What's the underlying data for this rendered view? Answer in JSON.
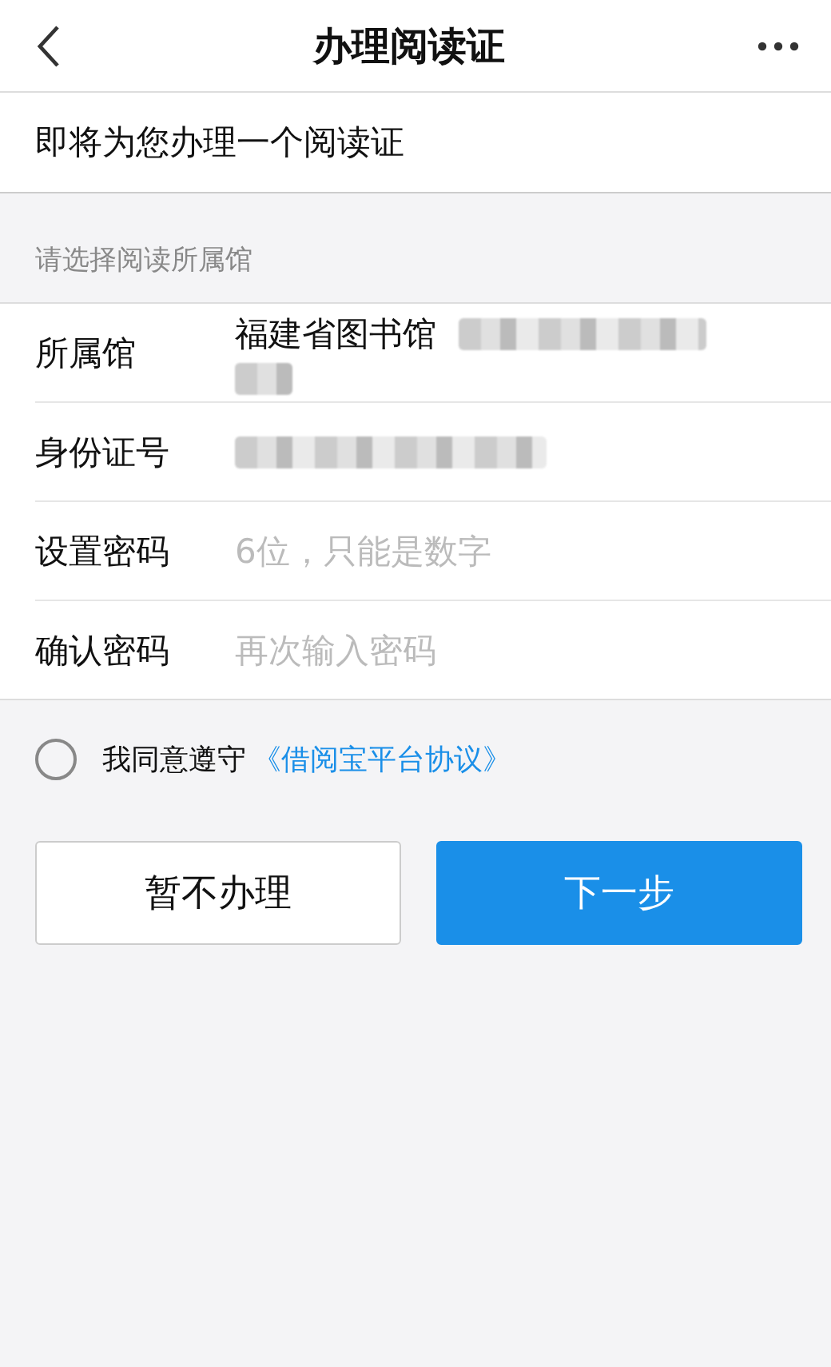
{
  "header": {
    "title": "办理阅读证"
  },
  "intro": "即将为您办理一个阅读证",
  "section_label": "请选择阅读所属馆",
  "fields": [
    {
      "kind": "value",
      "label": "所属馆",
      "value": "福建省图书馆",
      "redacted": true
    },
    {
      "kind": "redacted",
      "label": "身份证号"
    },
    {
      "kind": "input",
      "label": "设置密码",
      "placeholder": "6位，只能是数字"
    },
    {
      "kind": "input",
      "label": "确认密码",
      "placeholder": "再次输入密码"
    }
  ],
  "agreement": {
    "checked": false,
    "text": "我同意遵守",
    "link": "《借阅宝平台协议》"
  },
  "buttons": [
    {
      "kind": "secondary",
      "label": "暂不办理"
    },
    {
      "kind": "primary",
      "label": "下一步"
    }
  ]
}
